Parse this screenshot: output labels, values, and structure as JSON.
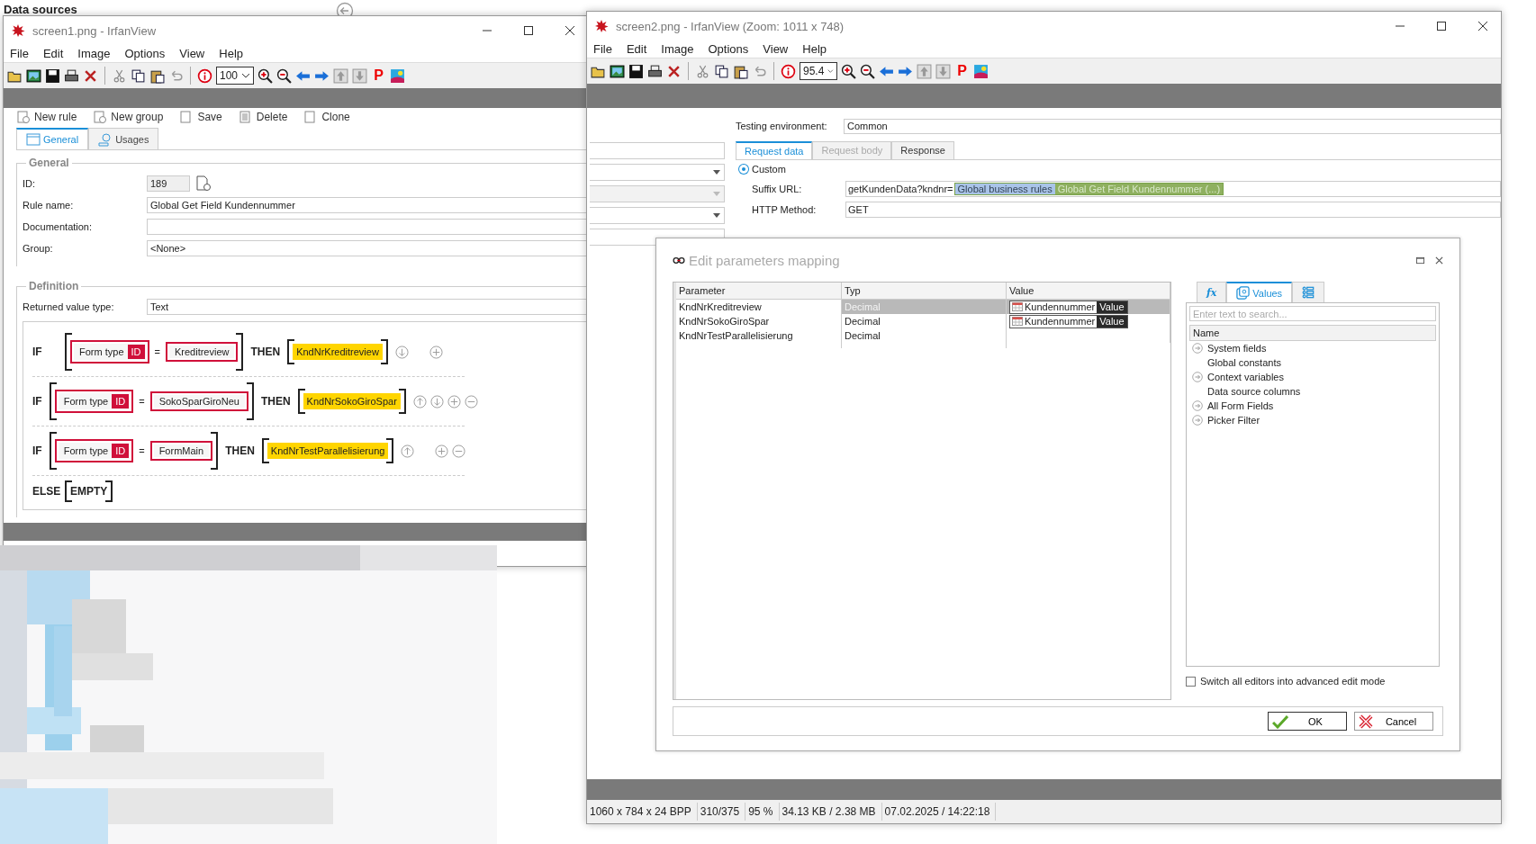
{
  "background": {
    "heading": "Data sources"
  },
  "left_window": {
    "title": "screen1.png - IrfanView",
    "menu": [
      "File",
      "Edit",
      "Image",
      "Options",
      "View",
      "Help"
    ],
    "zoom": "100",
    "toolbar_letter": "P",
    "content": {
      "toolbar": [
        "New rule",
        "New group",
        "Save",
        "Delete",
        "Clone"
      ],
      "tabs": [
        {
          "label": "General",
          "selected": true
        },
        {
          "label": "Usages",
          "selected": false
        }
      ],
      "general": {
        "legend": "General",
        "fields": [
          {
            "label": "ID:",
            "value": "189",
            "kind": "readonly"
          },
          {
            "label": "Rule name:",
            "value": "Global Get Field Kundennummer",
            "kind": "text"
          },
          {
            "label": "Documentation:",
            "kind": "text"
          },
          {
            "label": "Group:",
            "value": "<None>",
            "kind": "text"
          }
        ]
      },
      "definition": {
        "legend": "Definition",
        "return_label": "Returned value type:",
        "return_value": "Text",
        "rules": [
          {
            "keyword": "IF",
            "field": "Form type",
            "badge": "ID",
            "operator": "=",
            "operand": "Kreditreview",
            "then": "THEN",
            "result": "KndNrKreditreview",
            "actions": [
              {
                "kind": "down"
              },
              {
                "kind": "add"
              }
            ]
          },
          {
            "keyword": "IF",
            "field": "Form type",
            "badge": "ID",
            "operator": "=",
            "operand": "SokoSparGiroNeu",
            "then": "THEN",
            "result": "KndNrSokoGiroSpar",
            "actions": [
              {
                "kind": "up"
              },
              {
                "kind": "down"
              },
              {
                "kind": "add"
              },
              {
                "kind": "remove"
              }
            ]
          },
          {
            "keyword": "IF",
            "field": "Form type",
            "badge": "ID",
            "operator": "=",
            "operand": "FormMain",
            "then": "THEN",
            "result": "KndNrTestParallelisierung",
            "actions": [
              {
                "kind": "up"
              },
              {
                "kind": "add"
              },
              {
                "kind": "remove"
              }
            ]
          }
        ],
        "else": {
          "keyword": "ELSE",
          "value": "EMPTY"
        }
      }
    }
  },
  "right_window": {
    "title": "screen2.png - IrfanView (Zoom: 1011 x 748)",
    "menu": [
      "File",
      "Edit",
      "Image",
      "Options",
      "View",
      "Help"
    ],
    "zoom": "95.4",
    "toolbar_letter": "P",
    "content": {
      "testing_label": "Testing environment:",
      "testing_value": "Common",
      "tabs": [
        {
          "label": "Request data",
          "selected": true,
          "disabled": false
        },
        {
          "label": "Request body",
          "selected": false,
          "disabled": true
        },
        {
          "label": "Response",
          "selected": false,
          "disabled": false
        }
      ],
      "custom_radio": {
        "label": "Custom",
        "checked": true
      },
      "suffix": {
        "label": "Suffix URL:",
        "text": "getKundenData?kndnr=",
        "token_group": "Global business rules",
        "token_name": "Global Get Field Kundennummer (...)"
      },
      "method": {
        "label": "HTTP Method:",
        "value": "GET"
      }
    },
    "dialog": {
      "title": "Edit parameters mapping",
      "columns": [
        "Parameter",
        "Typ",
        "Value"
      ],
      "rows": [
        {
          "parameter": "KndNrKreditreview",
          "type": "Decimal",
          "value_field": "Kundennummer",
          "value_part": "Value",
          "selected": true
        },
        {
          "parameter": "KndNrSokoGiroSpar",
          "type": "Decimal",
          "value_field": "Kundennummer",
          "value_part": "Value",
          "selected": false
        },
        {
          "parameter": "KndNrTestParallelisierung",
          "type": "Decimal",
          "selected": false
        }
      ],
      "side_tabs": [
        {
          "kind": "formula",
          "label": "fx",
          "selected": false
        },
        {
          "kind": "values",
          "label": "Values",
          "selected": true
        },
        {
          "kind": "list",
          "selected": false
        }
      ],
      "search": {
        "placeholder": "Enter text to search..."
      },
      "tree_header": "Name",
      "tree": [
        {
          "label": "System fields",
          "expandable": true
        },
        {
          "label": "Global constants",
          "expandable": false
        },
        {
          "label": "Context variables",
          "expandable": true
        },
        {
          "label": "Data source columns",
          "expandable": false
        },
        {
          "label": "All Form Fields",
          "expandable": true
        },
        {
          "label": "Picker Filter",
          "expandable": true
        }
      ],
      "advanced_mode": {
        "label": "Switch all editors into advanced edit mode",
        "checked": false
      },
      "buttons": [
        {
          "kind": "ok",
          "label": "OK"
        },
        {
          "kind": "cancel",
          "label": "Cancel"
        }
      ]
    },
    "status_bar": [
      "1060 x 784 x 24 BPP",
      "310/375",
      "95 %",
      "34.13 KB / 2.38 MB",
      "07.02.2025 / 14:22:18"
    ]
  }
}
